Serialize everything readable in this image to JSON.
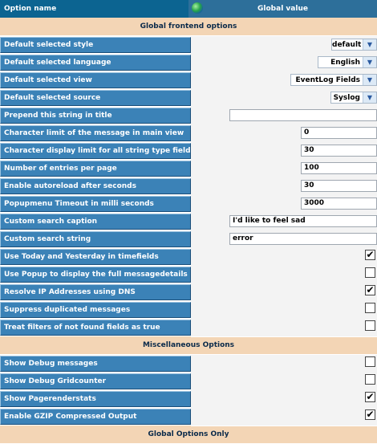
{
  "header": {
    "option_col": "Option name",
    "value_col": "Global value"
  },
  "sections": {
    "frontend": "Global frontend options",
    "misc": "Miscellaneous Options",
    "global_only": "Global Options Only"
  },
  "options": {
    "style": {
      "label": "Default selected style",
      "value": "default"
    },
    "language": {
      "label": "Default selected language",
      "value": "English"
    },
    "view": {
      "label": "Default selected view",
      "value": "EventLog Fields"
    },
    "source": {
      "label": "Default selected source",
      "value": "Syslog"
    },
    "prepend": {
      "label": "Prepend this string in title",
      "value": ""
    },
    "char_limit": {
      "label": "Character limit of the message in main view",
      "value": "0"
    },
    "char_display": {
      "label": "Character display limit for all string type fields",
      "value": "30"
    },
    "entries": {
      "label": "Number of entries per page",
      "value": "100"
    },
    "autoreload": {
      "label": "Enable autoreload after seconds",
      "value": "30"
    },
    "popup_timeout": {
      "label": "Popupmenu Timeout in milli seconds",
      "value": "3000"
    },
    "search_caption": {
      "label": "Custom search caption",
      "value": "I'd like to feel sad"
    },
    "search_string": {
      "label": "Custom search string",
      "value": "error"
    },
    "today_yesterday": {
      "label": "Use Today and Yesterday in timefields",
      "checked": "✔"
    },
    "popup_details": {
      "label": "Use Popup to display the full messagedetails",
      "checked": ""
    },
    "resolve_ip": {
      "label": "Resolve IP Addresses using DNS",
      "checked": "✔"
    },
    "suppress_dup": {
      "label": "Suppress duplicated messages",
      "checked": ""
    },
    "treat_filters": {
      "label": "Treat filters of not found fields as true",
      "checked": ""
    },
    "debug_msgs": {
      "label": "Show Debug messages",
      "checked": ""
    },
    "debug_grid": {
      "label": "Show Debug Gridcounter",
      "checked": ""
    },
    "pagerender": {
      "label": "Show Pagerenderstats",
      "checked": "✔"
    },
    "gzip": {
      "label": "Enable GZIP Compressed Output",
      "checked": "✔"
    }
  },
  "icons": {
    "header_icon": "globe-icon",
    "dropdown": "chevron-down-icon"
  }
}
